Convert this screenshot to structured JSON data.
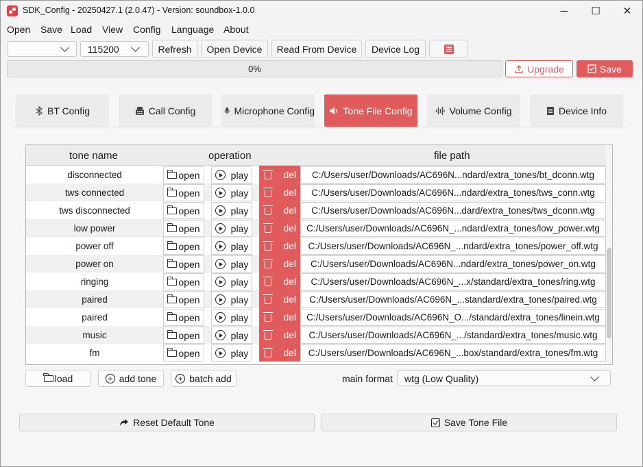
{
  "window": {
    "title": "SDK_Config -  20250427.1  (2.0.47) - Version: soundbox-1.0.0",
    "minimize": "─",
    "maximize": "☐",
    "close": "✕"
  },
  "menu": {
    "items": [
      "Open",
      "Save",
      "Load",
      "View",
      "Config",
      "Language",
      "About"
    ]
  },
  "toolbar": {
    "port_value": "",
    "baud_value": "115200",
    "refresh": "Refresh",
    "open_device": "Open Device",
    "read_from_device": "Read From Device",
    "device_log": "Device Log",
    "settings_icon": "sliders-icon"
  },
  "progress": {
    "text": "0%",
    "value": 0
  },
  "actions": {
    "upgrade": "Upgrade",
    "save": "Save"
  },
  "tabs": [
    {
      "label": "BT Config",
      "icon": "bluetooth-icon",
      "active": false
    },
    {
      "label": "Call Config",
      "icon": "phone-icon",
      "active": false
    },
    {
      "label": "Microphone Config",
      "icon": "microphone-icon",
      "active": false
    },
    {
      "label": "Tone File Config",
      "icon": "speaker-icon",
      "active": true
    },
    {
      "label": "Volume Config",
      "icon": "waveform-icon",
      "active": false
    },
    {
      "label": "Device Info",
      "icon": "document-icon",
      "active": false
    }
  ],
  "table": {
    "headers": {
      "name": "tone name",
      "operation": "operation",
      "path": "file path"
    },
    "open_label": "open",
    "play_label": "play",
    "del_label": "del",
    "rows": [
      {
        "name": "disconnected",
        "path": "C:/Users/user/Downloads/AC696N...ndard/extra_tones/bt_dconn.wtg"
      },
      {
        "name": "tws connected",
        "path": "C:/Users/user/Downloads/AC696N...ndard/extra_tones/tws_conn.wtg"
      },
      {
        "name": "tws disconnected",
        "path": "C:/Users/user/Downloads/AC696N...dard/extra_tones/tws_dconn.wtg"
      },
      {
        "name": "low power",
        "path": "C:/Users/user/Downloads/AC696N_...ndard/extra_tones/low_power.wtg"
      },
      {
        "name": "power off",
        "path": "C:/Users/user/Downloads/AC696N_...ndard/extra_tones/power_off.wtg"
      },
      {
        "name": "power on",
        "path": "C:/Users/user/Downloads/AC696N...ndard/extra_tones/power_on.wtg"
      },
      {
        "name": "ringing",
        "path": "C:/Users/user/Downloads/AC696N_...x/standard/extra_tones/ring.wtg"
      },
      {
        "name": "paired",
        "path": "C:/Users/user/Downloads/AC696N_...standard/extra_tones/paired.wtg"
      },
      {
        "name": "paired",
        "path": "C:/Users/user/Downloads/AC696N_O.../standard/extra_tones/linein.wtg"
      },
      {
        "name": "music",
        "path": "C:/Users/user/Downloads/AC696N_.../standard/extra_tones/music.wtg"
      },
      {
        "name": "fm",
        "path": "C:/Users/user/Downloads/AC696N_...box/standard/extra_tones/fm.wtg"
      }
    ]
  },
  "bottom": {
    "load": "load",
    "add_tone": "add tone",
    "batch_add": "batch add",
    "main_format_label": "main format",
    "main_format_value": "wtg (Low Quality)",
    "reset_default_tone": "Reset Default Tone",
    "save_tone_file": "Save Tone File"
  }
}
